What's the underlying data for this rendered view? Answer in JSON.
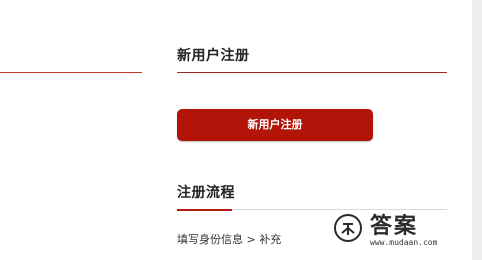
{
  "register_section": {
    "title": "新用户注册",
    "button_label": "新用户注册"
  },
  "flow_section": {
    "title": "注册流程",
    "steps_text": "填写身份信息 > 补充"
  },
  "watermark": {
    "brand": "答案",
    "url": "www.mudaan.com"
  },
  "colors": {
    "accent": "#b3140a",
    "rule": "#9e2a1f",
    "background": "#eeeeee",
    "panel": "#ffffff"
  }
}
